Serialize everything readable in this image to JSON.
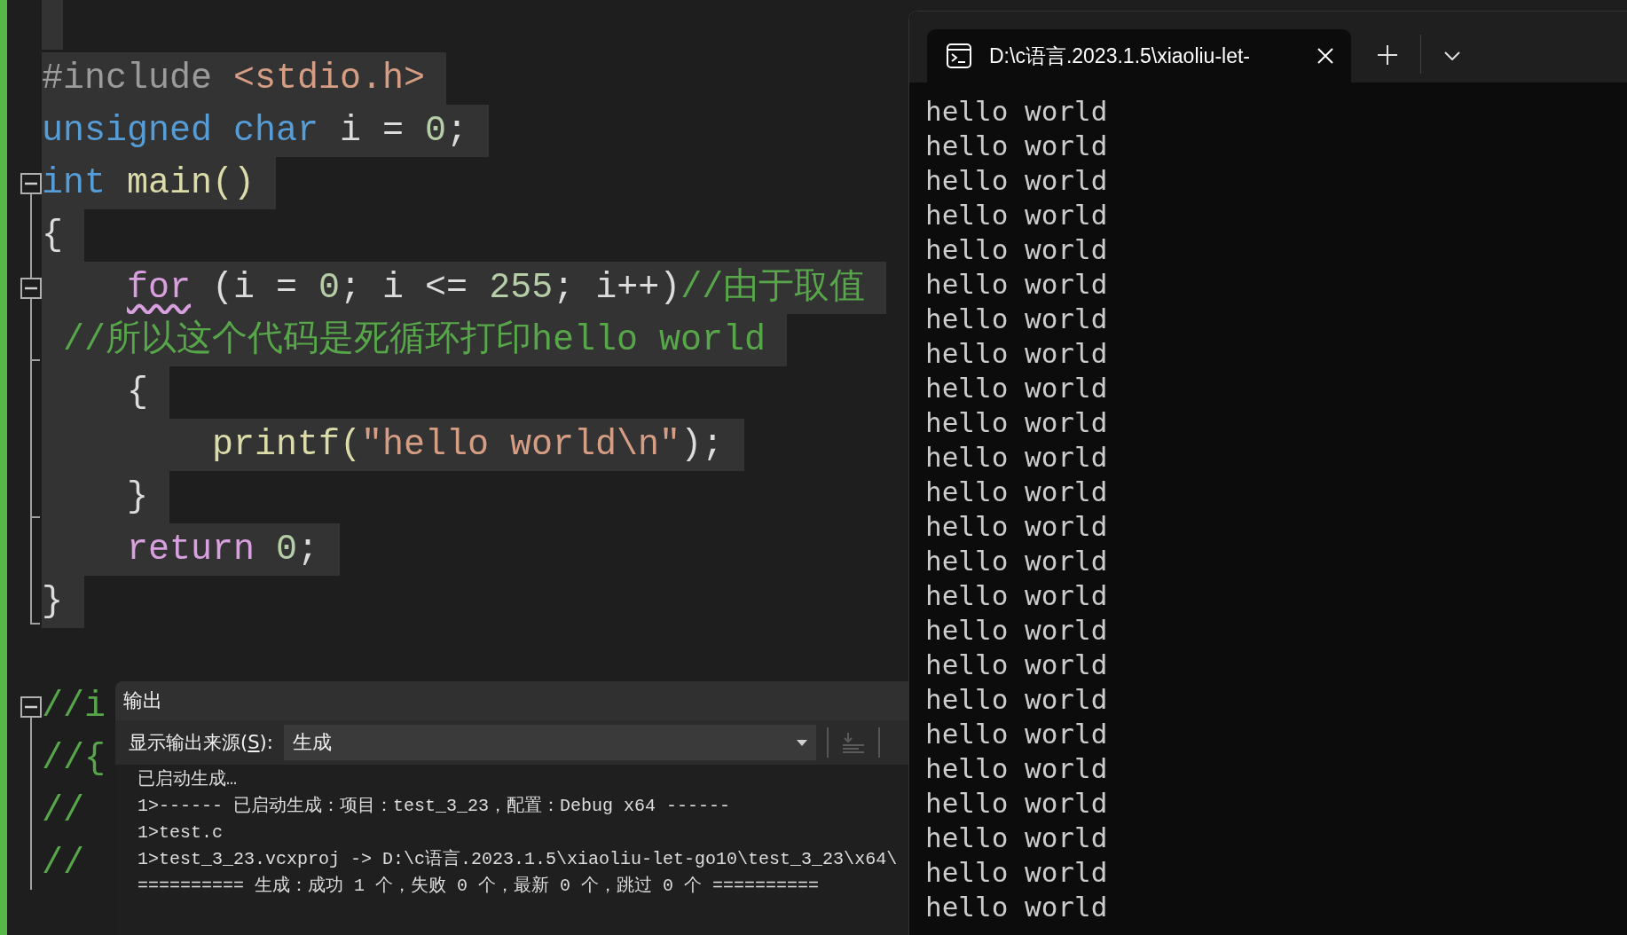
{
  "editor": {
    "lines": [
      {
        "kind": "blank",
        "selected": true
      },
      {
        "kind": "code",
        "selected": true,
        "tokens": [
          {
            "text": "#include ",
            "kind": "preproc"
          },
          {
            "text": "<stdio.h>",
            "kind": "string"
          }
        ]
      },
      {
        "kind": "code",
        "selected": true,
        "tokens": [
          {
            "text": "unsigned char ",
            "kind": "keyword"
          },
          {
            "text": "i = ",
            "kind": "plain"
          },
          {
            "text": "0",
            "kind": "number"
          },
          {
            "text": ";",
            "kind": "plain"
          }
        ]
      },
      {
        "kind": "code",
        "selected": true,
        "fold": {
          "kind": "toggle",
          "expanded": true
        },
        "tokens": [
          {
            "text": "int ",
            "kind": "keyword"
          },
          {
            "text": "main()",
            "kind": "function"
          }
        ]
      },
      {
        "kind": "code",
        "selected": true,
        "fold": {
          "kind": "line"
        },
        "tokens": [
          {
            "text": "{",
            "kind": "plain"
          }
        ]
      },
      {
        "kind": "code",
        "selected": true,
        "fold": {
          "kind": "nested_toggle",
          "expanded": true
        },
        "tokens": [
          {
            "text": "    for",
            "kind": "control",
            "squiggle": true
          },
          {
            "text": " (i = ",
            "kind": "plain"
          },
          {
            "text": "0",
            "kind": "number"
          },
          {
            "text": "; i <= ",
            "kind": "plain"
          },
          {
            "text": "255",
            "kind": "number"
          },
          {
            "text": "; i++)",
            "kind": "plain"
          },
          {
            "text": "//由于取值",
            "kind": "comment"
          }
        ]
      },
      {
        "kind": "code",
        "selected": true,
        "fold": {
          "kind": "end"
        },
        "tokens": [
          {
            "text": " //所以这个代码是死循环打印hello world",
            "kind": "comment"
          }
        ]
      },
      {
        "kind": "code",
        "selected": true,
        "fold": {
          "kind": "line"
        },
        "tokens": [
          {
            "text": "    {",
            "kind": "plain"
          }
        ]
      },
      {
        "kind": "code",
        "selected": true,
        "fold": {
          "kind": "line"
        },
        "tokens": [
          {
            "text": "        printf(",
            "kind": "function"
          },
          {
            "text": "\"hello world\\n\"",
            "kind": "string"
          },
          {
            "text": ");",
            "kind": "plain"
          }
        ]
      },
      {
        "kind": "code",
        "selected": true,
        "fold": {
          "kind": "end"
        },
        "tokens": [
          {
            "text": "    }",
            "kind": "plain"
          }
        ]
      },
      {
        "kind": "code",
        "selected": true,
        "fold": {
          "kind": "line"
        },
        "tokens": [
          {
            "text": "    return",
            "kind": "control"
          },
          {
            "text": " 0",
            "kind": "number"
          },
          {
            "text": ";",
            "kind": "plain"
          }
        ]
      },
      {
        "kind": "code",
        "selected": true,
        "fold": {
          "kind": "last"
        },
        "tokens": [
          {
            "text": "}",
            "kind": "plain"
          }
        ]
      },
      {
        "kind": "blank",
        "selected": false
      },
      {
        "kind": "code",
        "selected": false,
        "fold": {
          "kind": "toggle",
          "expanded": true
        },
        "tokens": [
          {
            "text": "//i",
            "kind": "comment"
          }
        ]
      },
      {
        "kind": "code",
        "selected": false,
        "fold": {
          "kind": "line"
        },
        "tokens": [
          {
            "text": "//{",
            "kind": "comment"
          }
        ]
      },
      {
        "kind": "code",
        "selected": false,
        "fold": {
          "kind": "line"
        },
        "tokens": [
          {
            "text": "//",
            "kind": "comment"
          }
        ]
      },
      {
        "kind": "code",
        "selected": false,
        "fold": {
          "kind": "line"
        },
        "tokens": [
          {
            "text": "//",
            "kind": "comment"
          }
        ]
      }
    ]
  },
  "output_panel": {
    "title": "输出",
    "source_label": {
      "before": "显示输出来源(",
      "access_key": "S",
      "after": "):"
    },
    "source_value": "生成",
    "wrap_button": {
      "disabled": true
    },
    "lines": [
      "已启动生成…",
      "1>------ 已启动生成：项目：test_3_23，配置：Debug x64 ------",
      "1>test.c",
      "1>test_3_23.vcxproj -> D:\\c语言.2023.1.5\\xiaoliu-let-go10\\test_3_23\\x64\\",
      "========== 生成：成功 1 个，失败 0 个，最新 0 个，跳过 0 个 =========="
    ]
  },
  "terminal": {
    "tab": {
      "title": "D:\\c语言.2023.1.5\\xiaoliu-let-",
      "selected": true
    },
    "lines": [
      "hello world",
      "hello world",
      "hello world",
      "hello world",
      "hello world",
      "hello world",
      "hello world",
      "hello world",
      "hello world",
      "hello world",
      "hello world",
      "hello world",
      "hello world",
      "hello world",
      "hello world",
      "hello world",
      "hello world",
      "hello world",
      "hello world",
      "hello world",
      "hello world",
      "hello world",
      "hello world",
      "hello world"
    ]
  }
}
